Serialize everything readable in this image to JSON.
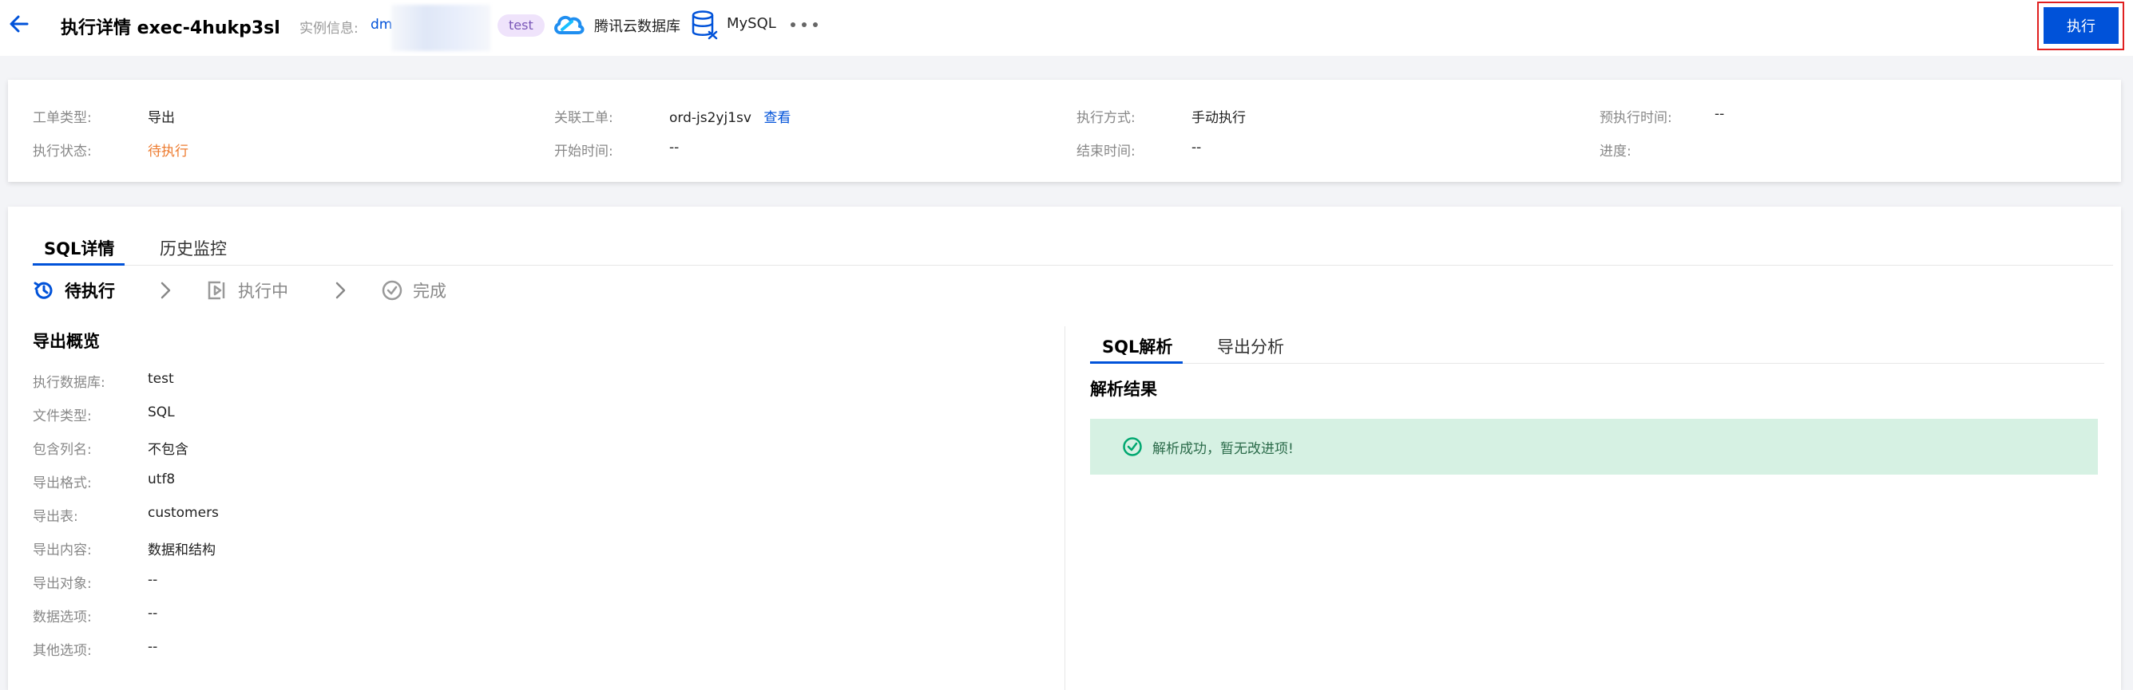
{
  "header": {
    "title": "执行详情 exec-4hukp3sl",
    "instance_label": "实例信息:",
    "instance_value": "dm",
    "env_tag": "test",
    "cloud_name": "腾讯云数据库",
    "db_type": "MySQL",
    "execute_button": "执行",
    "accent_color": "#0052d9"
  },
  "info": {
    "order_type_label": "工单类型:",
    "order_type_value": "导出",
    "related_order_label": "关联工单:",
    "related_order_value": "ord-js2yj1sv",
    "view_link": "查看",
    "exec_mode_label": "执行方式:",
    "exec_mode_value": "手动执行",
    "planned_time_label": "预执行时间:",
    "planned_time_value": "--",
    "exec_status_label": "执行状态:",
    "exec_status_value": "待执行",
    "start_time_label": "开始时间:",
    "start_time_value": "--",
    "end_time_label": "结束时间:",
    "end_time_value": "--",
    "progress_label": "进度:",
    "status_color": "#ed7b2f"
  },
  "tabs": [
    {
      "label": "SQL详情"
    },
    {
      "label": "历史监控"
    }
  ],
  "steps": [
    {
      "label": "待执行",
      "icon": "history-icon",
      "state": "active"
    },
    {
      "label": "执行中",
      "icon": "play-box-icon",
      "state": "todo"
    },
    {
      "label": "完成",
      "icon": "check-circle-icon",
      "state": "todo"
    }
  ],
  "overview": {
    "title": "导出概览",
    "rows": [
      {
        "label": "执行数据库:",
        "value": "test"
      },
      {
        "label": "文件类型:",
        "value": "SQL"
      },
      {
        "label": "包含列名:",
        "value": "不包含"
      },
      {
        "label": "导出格式:",
        "value": "utf8"
      },
      {
        "label": "导出表:",
        "value": "customers"
      },
      {
        "label": "导出内容:",
        "value": "数据和结构"
      },
      {
        "label": "导出对象:",
        "value": "--"
      },
      {
        "label": "数据选项:",
        "value": "--"
      },
      {
        "label": "其他选项:",
        "value": "--"
      }
    ]
  },
  "analysis": {
    "tabs": [
      {
        "label": "SQL解析"
      },
      {
        "label": "导出分析"
      }
    ],
    "result_title": "解析结果",
    "success_message": "解析成功，暂无改进项!",
    "success_color": "#00a870"
  }
}
